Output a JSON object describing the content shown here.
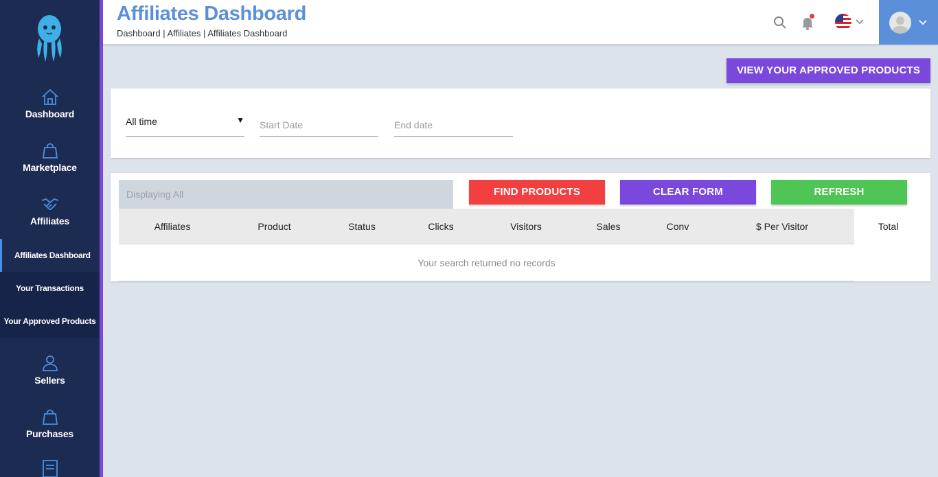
{
  "sidebar": {
    "logo": "octopus-logo",
    "items": [
      {
        "label": "Dashboard",
        "icon": "home-icon"
      },
      {
        "label": "Marketplace",
        "icon": "shopping-bag-icon"
      },
      {
        "label": "Affiliates",
        "icon": "handshake-icon"
      },
      {
        "label": "Sellers",
        "icon": "users-icon"
      },
      {
        "label": "Purchases",
        "icon": "shopping-bag-icon"
      }
    ],
    "submenu": [
      {
        "label": "Affiliates Dashboard",
        "active": true
      },
      {
        "label": "Your Transactions",
        "active": false
      },
      {
        "label": "Your Approved Products",
        "active": false
      }
    ],
    "accent": "#7b48d8"
  },
  "header": {
    "title": "Affiliates Dashboard",
    "breadcrumb": "Dashboard | Affiliates | Affiliates Dashboard",
    "title_color": "#5b8fd9",
    "icons": [
      "search-icon",
      "bell-icon",
      "us-flag-icon",
      "user-avatar"
    ]
  },
  "actions": {
    "view_approved": "VIEW YOUR APPROVED PRODUCTS"
  },
  "filters": {
    "period": "All time",
    "start_placeholder": "Start Date",
    "end_placeholder": "End date"
  },
  "results": {
    "displaying": "Displaying All",
    "find_label": "FIND PRODUCTS",
    "clear_label": "CLEAR FORM",
    "refresh_label": "REFRESH",
    "columns": [
      "Affiliates",
      "Product",
      "Status",
      "Clicks",
      "Visitors",
      "Sales",
      "Conv",
      "$ Per Visitor",
      "Total"
    ],
    "empty_message": "Your search returned no records",
    "colors": {
      "find": "#f1403f",
      "clear": "#7a48dc",
      "refresh": "#4fc556"
    }
  }
}
